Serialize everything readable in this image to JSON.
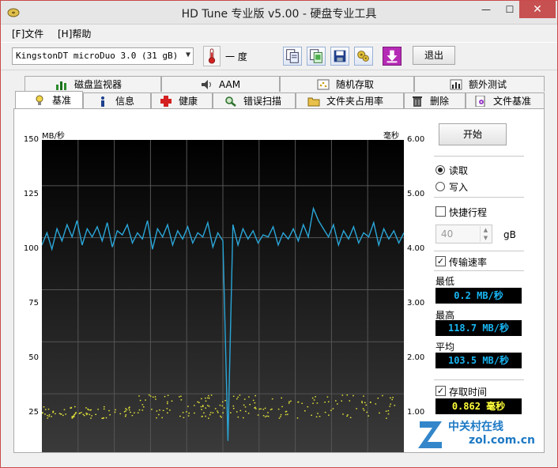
{
  "window": {
    "title": "HD Tune 专业版 v5.00 - 硬盘专业工具",
    "controls": {
      "minimize": "—",
      "maximize": "☐",
      "close": "✕"
    }
  },
  "menu": {
    "file": "[F]文件",
    "help": "[H]帮助"
  },
  "toolbar": {
    "drive": "KingstonDT microDuo 3.0  (31 gB)",
    "temperature": "一 度",
    "exit_label": "退出"
  },
  "tabs": {
    "row1": [
      "磁盘监视器",
      "AAM",
      "随机存取",
      "额外测试"
    ],
    "row2": [
      "基准",
      "信息",
      "健康",
      "错误扫描",
      "文件夹占用率",
      "删除",
      "文件基准"
    ]
  },
  "chart_data": {
    "type": "line",
    "left_unit": "MB/秒",
    "right_unit": "毫秒",
    "left_ticks": [
      "150",
      "125",
      "100",
      "75",
      "50",
      "25"
    ],
    "right_ticks": [
      "6.00",
      "5.00",
      "4.00",
      "3.00",
      "2.00",
      "1.00"
    ],
    "ylim_left": [
      0,
      150
    ],
    "ylim_right": [
      0,
      6.0
    ],
    "series": [
      {
        "name": "传输速率",
        "color": "#2aa6d8",
        "values": [
          100,
          106,
          98,
          108,
          102,
          110,
          104,
          112,
          100,
          108,
          104,
          109,
          102,
          111,
          99,
          107,
          105,
          110,
          101,
          106,
          103,
          112,
          98,
          108,
          104,
          110,
          100,
          107,
          103,
          109,
          101,
          106,
          104,
          111,
          99,
          106,
          102,
          4,
          110,
          100,
          108,
          103,
          107,
          101,
          105,
          104,
          109,
          100,
          106,
          103,
          108,
          102,
          110,
          104,
          118,
          112,
          108,
          104,
          110,
          100,
          107,
          103,
          109,
          101,
          106,
          104,
          111,
          100,
          108,
          103,
          107,
          101,
          106
        ]
      }
    ],
    "access_time_band": {
      "color": "#e7e73a",
      "low_ms": 0.6,
      "high_ms": 1.05
    }
  },
  "controls": {
    "start_label": "开始",
    "read_label": "读取",
    "write_label": "写入",
    "quick_stroke_label": "快捷行程",
    "quick_stroke_value": "40",
    "quick_stroke_unit": "gB",
    "transfer_rate_label": "传输速率",
    "min_label": "最低",
    "min_value": "0.2 MB/秒",
    "max_label": "最高",
    "max_value": "118.7 MB/秒",
    "avg_label": "平均",
    "avg_value": "103.5 MB/秒",
    "access_time_label": "存取时间",
    "access_time_value": "0.862 毫秒"
  },
  "watermark": {
    "text": "中关村在线",
    "domain": "zol.com.cn"
  }
}
